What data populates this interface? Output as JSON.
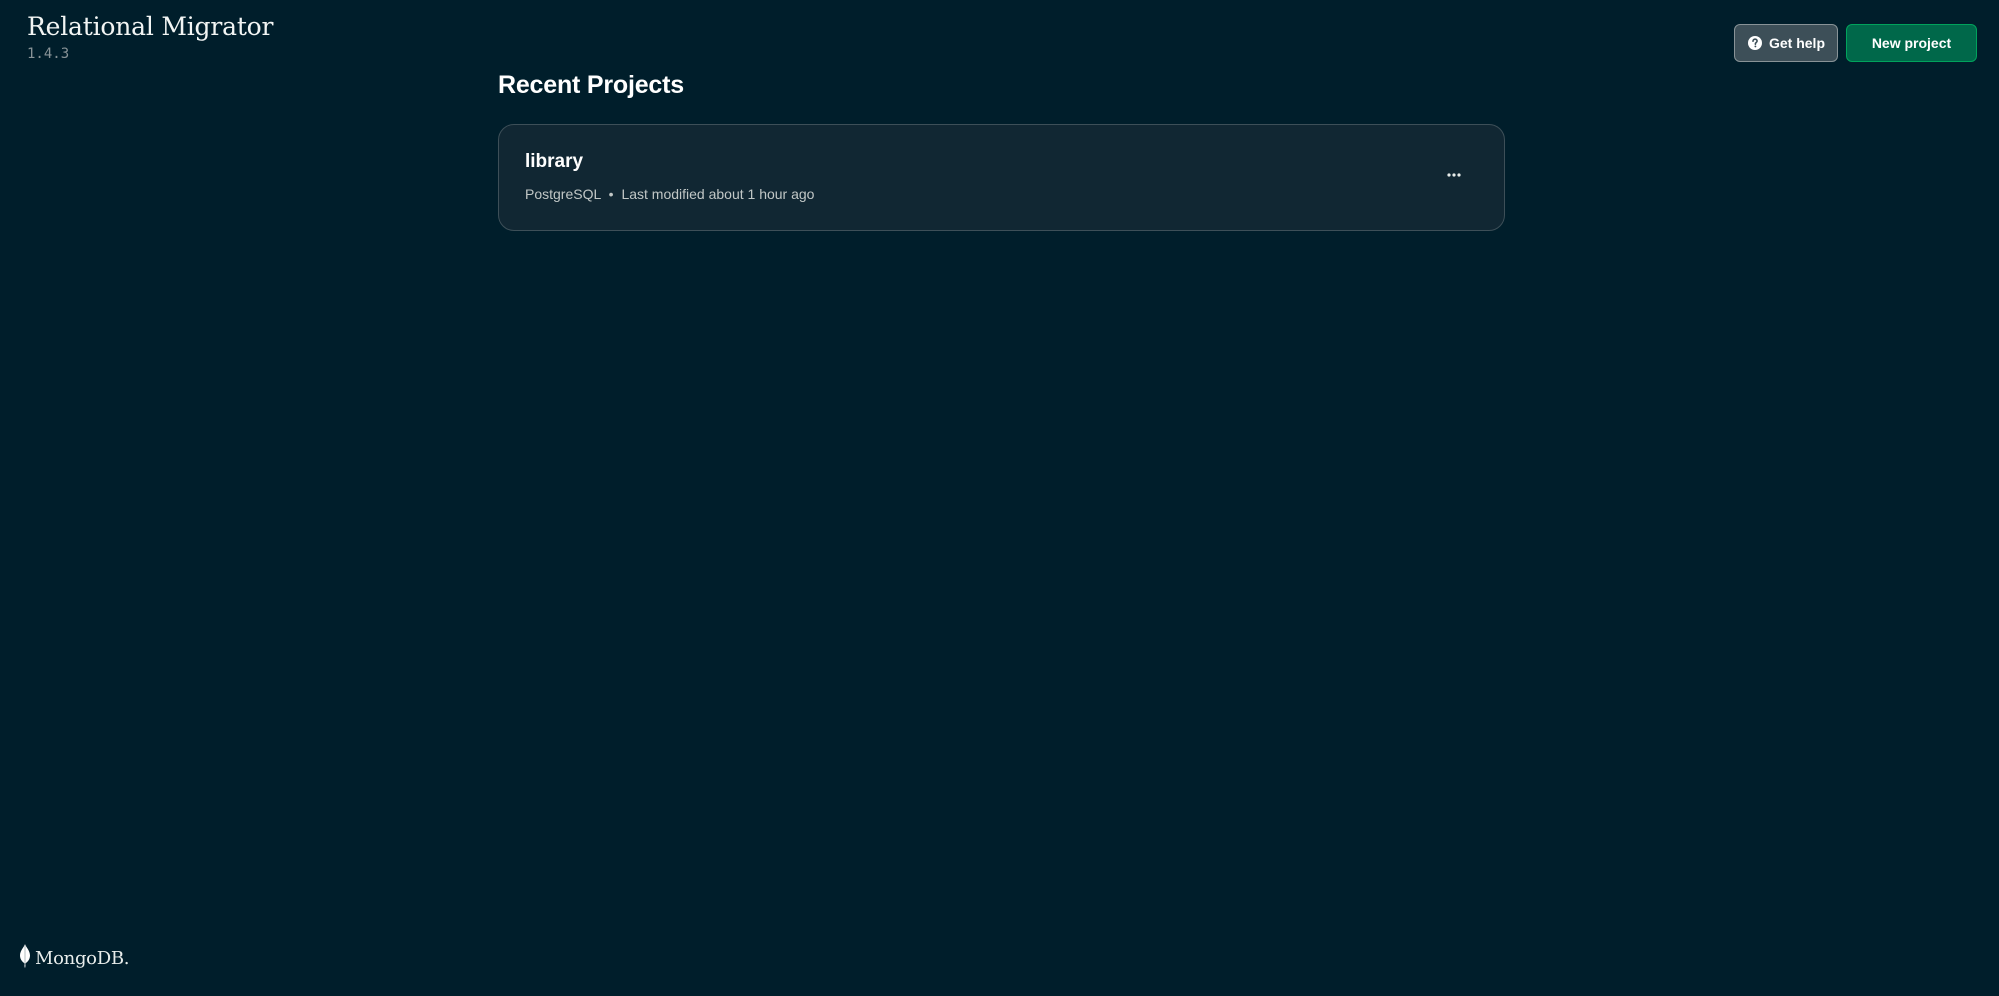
{
  "app": {
    "title": "Relational Migrator",
    "version": "1.4.3"
  },
  "header": {
    "help_label": "Get help",
    "new_project_label": "New project",
    "help_icon": "question-circle-icon"
  },
  "main": {
    "section_title": "Recent Projects",
    "projects": [
      {
        "name": "library",
        "database": "PostgreSQL",
        "separator": "•",
        "modified": "Last modified about 1 hour ago",
        "menu_icon": "ellipsis-icon"
      }
    ]
  },
  "footer": {
    "logo_text": "MongoDB.",
    "logo_icon": "leaf-icon"
  },
  "colors": {
    "background": "#001e2b",
    "card": "#112733",
    "card_border": "#3d4f58",
    "primary_button": "#00684a",
    "primary_button_border": "#00a35c",
    "secondary_button": "#3d4f58",
    "leaf": "#ffffff"
  }
}
